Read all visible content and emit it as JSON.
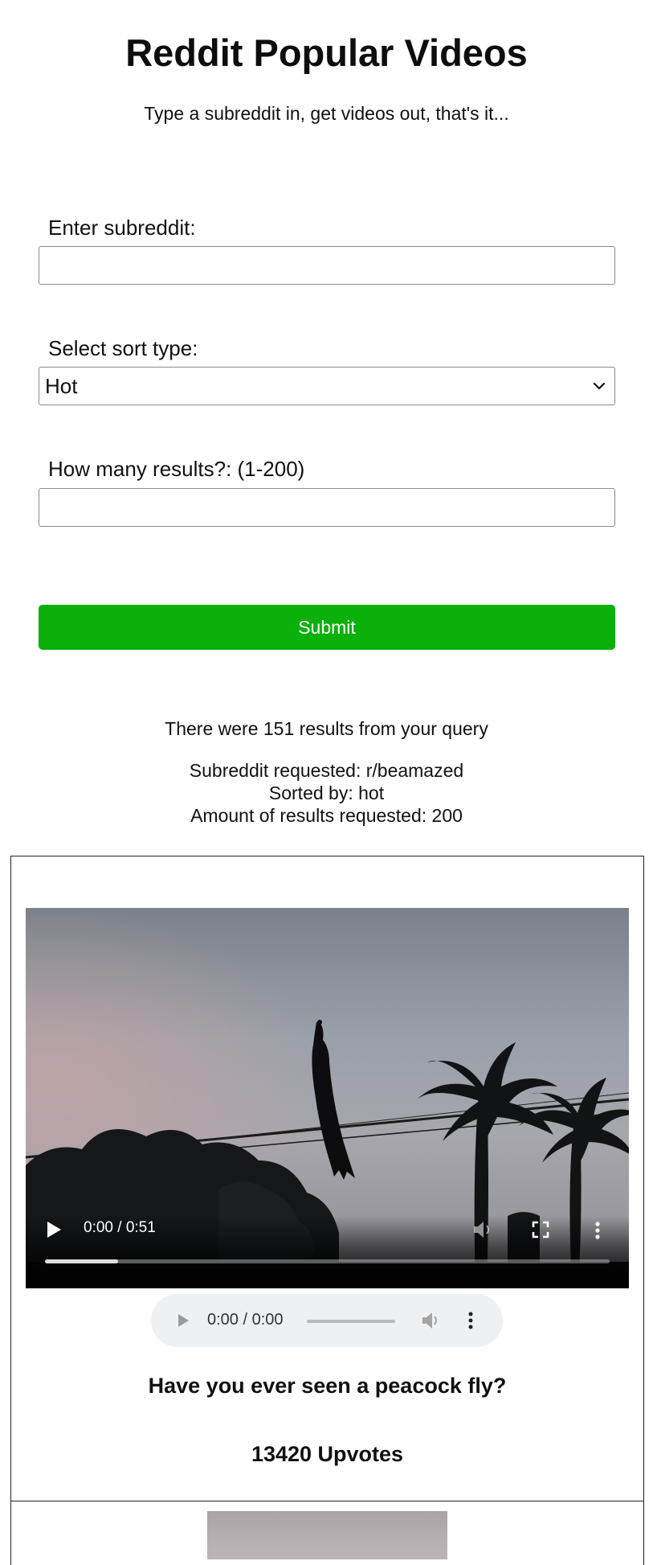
{
  "header": {
    "title": "Reddit Popular Videos",
    "subtitle": "Type a subreddit in, get videos out, that's it..."
  },
  "form": {
    "subreddit_label": "Enter subreddit:",
    "subreddit_value": "",
    "sort_label": "Select sort type:",
    "sort_selected": "Hot",
    "count_label": "How many results?: (1-200)",
    "count_value": "",
    "submit_label": "Submit",
    "submit_color": "#0bb00b"
  },
  "query_summary": {
    "results_text": "There were 151 results from your query",
    "subreddit_text": "Subreddit requested: r/beamazed",
    "sorted_text": "Sorted by: hot",
    "amount_text": "Amount of results requested: 200"
  },
  "posts": [
    {
      "video": {
        "time": "0:00 / 0:51",
        "progress_fraction": 0.13
      },
      "audio": {
        "time": "0:00 / 0:00"
      },
      "title": "Have you ever seen a peacock fly?",
      "upvotes": "13420 Upvotes"
    }
  ],
  "icons": {
    "select_arrow": "chevron-down-icon",
    "video_play": "play-icon",
    "video_volume": "volume-icon",
    "video_fullscreen": "fullscreen-icon",
    "video_more": "more-vertical-icon",
    "audio_play": "play-icon",
    "audio_volume": "volume-icon",
    "audio_more": "more-vertical-icon"
  }
}
